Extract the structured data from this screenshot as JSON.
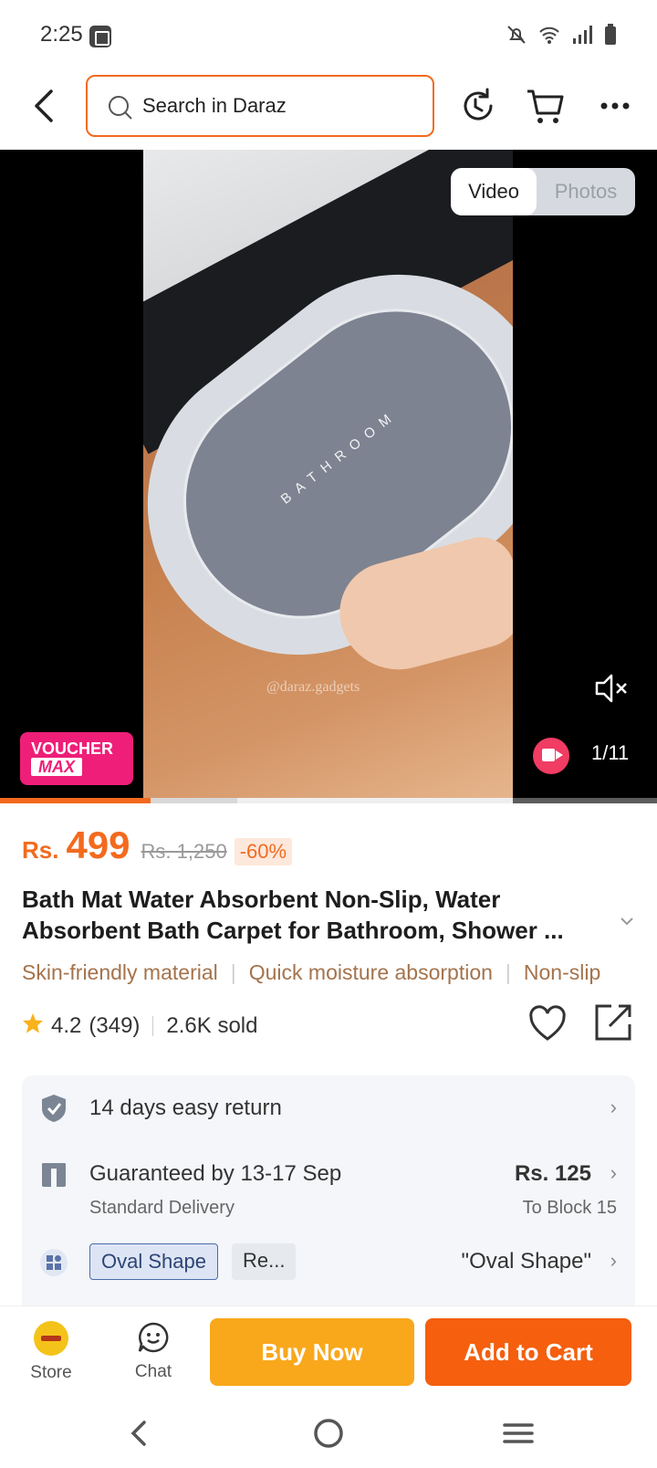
{
  "status_bar": {
    "time": "2:25"
  },
  "header": {
    "search_placeholder": "Search in Daraz"
  },
  "media": {
    "tabs": [
      {
        "label": "Video",
        "active": true
      },
      {
        "label": "Photos",
        "active": false
      }
    ],
    "mat_text": "BATHROOM",
    "watermark": "@daraz.gadgets",
    "counter": "1/11",
    "voucher_line1": "VOUCHER",
    "voucher_line2": "MAX",
    "progress_fraction": 0.23
  },
  "product": {
    "currency": "Rs.",
    "price": "499",
    "old_price": "Rs. 1,250",
    "discount": "-60%",
    "title": "Bath Mat Water Absorbent Non-Slip, Water Absorbent Bath Carpet for Bathroom, Shower ...",
    "features": [
      "Skin-friendly material",
      "Quick moisture absorption",
      "Non-slip"
    ],
    "rating": "4.2",
    "reviews": "(349)",
    "sold": "2.6K sold"
  },
  "info": {
    "return_text": "14 days easy return",
    "delivery_title": "Guaranteed by 13-17 Sep",
    "delivery_sub": "Standard Delivery",
    "delivery_price": "Rs. 125",
    "delivery_to": "To Block 15",
    "variants": [
      "Oval Shape",
      "Re..."
    ],
    "selected_variant": "\"Oval Shape\""
  },
  "bottom_bar": {
    "store_label": "Store",
    "chat_label": "Chat",
    "buy_now": "Buy Now",
    "add_to_cart": "Add to Cart"
  },
  "colors": {
    "accent": "#f36a1e",
    "buy_now": "#f9a81c",
    "add_to_cart": "#f55f0e",
    "voucher": "#ef1e78"
  }
}
